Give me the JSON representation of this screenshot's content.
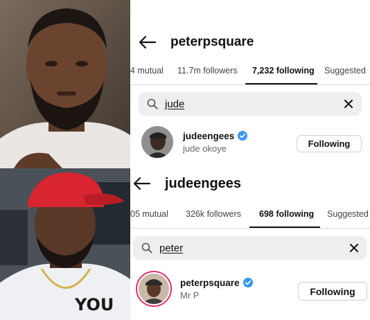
{
  "top": {
    "profile_title": "peterpsquare",
    "tabs": [
      "4 mutual",
      "11.7m followers",
      "7,232 following",
      "Suggested"
    ],
    "active_tab": "7,232 following",
    "search_query": "jude",
    "result": {
      "username": "judeengees",
      "full_name": "jude okoye",
      "button_label": "Following"
    }
  },
  "bottom": {
    "profile_title": "judeengees",
    "tabs": [
      "05 mutual",
      "326k followers",
      "698 following",
      "Suggested"
    ],
    "active_tab": "698 following",
    "search_query": "peter",
    "result": {
      "username": "peterpsquare",
      "full_name": "Mr P",
      "button_label": "Following"
    }
  },
  "colors": {
    "verified_blue": "#3897f0",
    "search_bg": "#eeeeee",
    "cap_red": "#d8252f",
    "story_ring": "#e1306c"
  },
  "icons": {
    "back": "arrow-left-icon",
    "search": "search-icon",
    "clear": "close-icon",
    "verified": "verified-badge-icon"
  }
}
